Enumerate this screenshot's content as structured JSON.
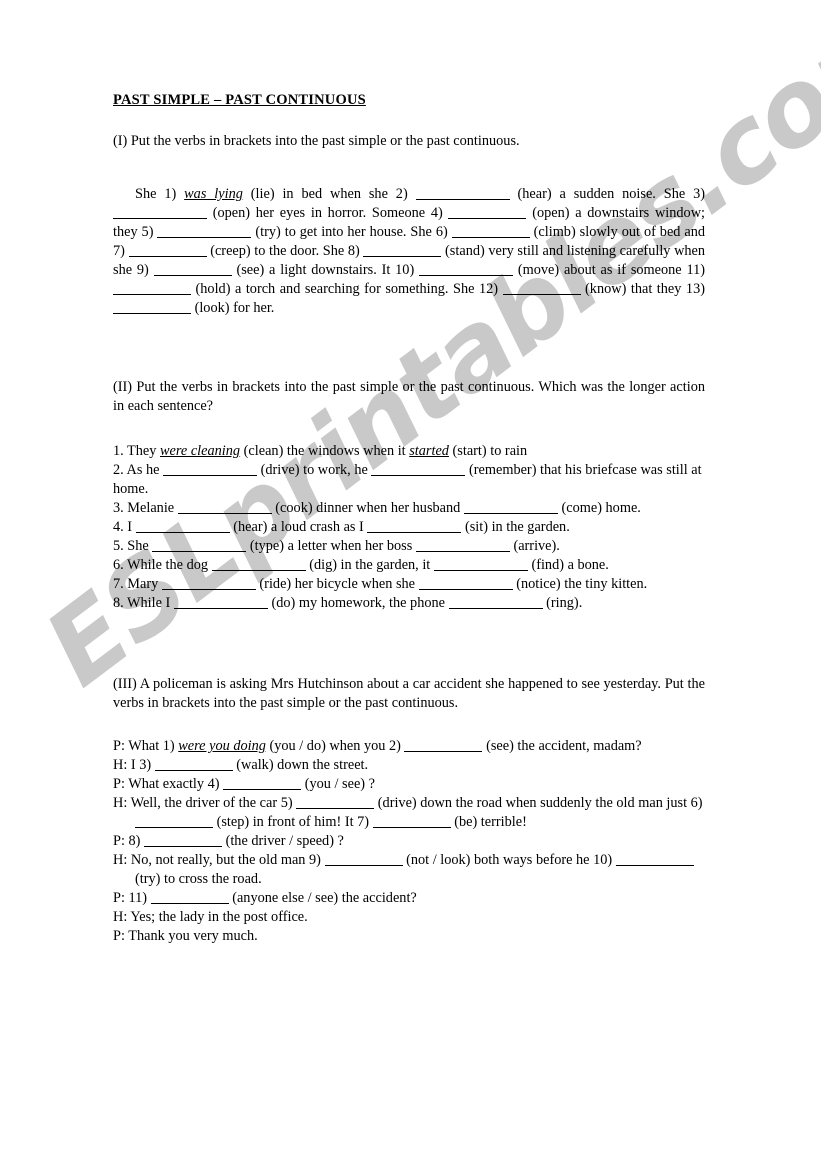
{
  "document": {
    "title": "PAST SIMPLE – PAST CONTINUOUS",
    "watermark": "ESLprintables.com",
    "watermark_color": "#c9c9c9"
  },
  "section_1": {
    "instruction": "(I) Put the verbs in brackets into the past simple or the past continuous.",
    "text_parts": {
      "p1": "She 1)",
      "answer1": "was lying",
      "p2": "(lie) in bed when she 2)",
      "p3": "(hear) a sudden noise. She 3)",
      "p4": "(open) her eyes in horror. Someone 4)",
      "p5": "(open) a downstairs window; they 5)",
      "p6": "(try) to get into her house. She 6)",
      "p7": "(climb) slowly out of bed and 7)",
      "p8": "(creep) to the door. She 8)",
      "p9": "(stand) very still and listening carefully when she 9)",
      "p10": "(see) a light downstairs. It 10)",
      "p11": "(move) about as if someone 11)",
      "p12": "(hold) a torch and searching for something. She 12)",
      "p13": "(know) that they 13)",
      "p14": "(look) for her."
    }
  },
  "section_2": {
    "instruction": "(II) Put the verbs in brackets into the past simple or the past continuous. Which was the longer action in each sentence?",
    "items": [
      {
        "num": "1. They",
        "answer_a": "were cleaning",
        "mid": "(clean) the windows when it",
        "answer_b": "started",
        "end": "(start) to rain"
      },
      {
        "num": "2. As he",
        "mid": "(drive) to work, he",
        "end": "(remember) that his briefcase was still at home."
      },
      {
        "num": "3. Melanie",
        "mid": "(cook) dinner when her husband",
        "end": "(come) home."
      },
      {
        "num": "4. I",
        "mid": "(hear) a loud crash as I",
        "end": "(sit) in the garden."
      },
      {
        "num": "5. She",
        "mid": "(type) a letter when her boss",
        "end": "(arrive)."
      },
      {
        "num": "6. While the dog",
        "mid": "(dig) in the garden, it",
        "end": "(find) a bone."
      },
      {
        "num": "7. Mary",
        "mid": "(ride) her bicycle when she",
        "end": "(notice) the tiny kitten."
      },
      {
        "num": "8. While I",
        "mid": "(do) my homework, the phone",
        "end": "(ring)."
      }
    ]
  },
  "section_3": {
    "instruction": "(III) A policeman is asking Mrs Hutchinson about a car accident she happened to see yesterday. Put the verbs in brackets into the past simple or the past continuous.",
    "dialogue": [
      {
        "speaker": "P: What 1)",
        "answer": "were you doing",
        "mid": "(you / do) when you  2)",
        "end": "(see) the accident, madam?"
      },
      {
        "speaker": "H: I 3)",
        "end": "(walk) down the street."
      },
      {
        "speaker": "P: What exactly 4)",
        "end": "(you / see) ?"
      },
      {
        "speaker": "H: Well, the driver of the car 5)",
        "mid": "(drive) down the road when suddenly the old man just 6)",
        "mid2": "(step) in front of him! It 7)",
        "end": "(be) terrible!"
      },
      {
        "speaker": "P: 8)",
        "end": "(the driver / speed) ?"
      },
      {
        "speaker": "H: No, not really, but the old man 9)",
        "mid": "(not / look) both ways before he 10)",
        "end": "(try) to cross the road."
      },
      {
        "speaker": "P: 11)",
        "end": "(anyone else / see) the accident?"
      },
      {
        "speaker": "H: Yes; the lady in the post office.",
        "plain": true
      },
      {
        "speaker": "P: Thank you very much.",
        "plain": true
      }
    ]
  }
}
